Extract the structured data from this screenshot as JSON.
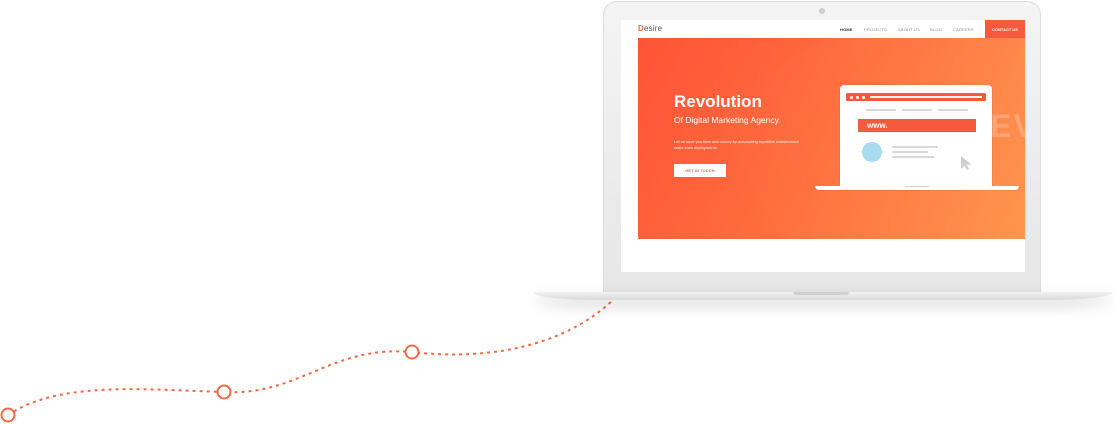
{
  "site": {
    "logo_initial": "D",
    "logo_rest": "esire",
    "nav": [
      {
        "label": "HOME",
        "active": true
      },
      {
        "label": "PROJECTS",
        "active": false
      },
      {
        "label": "ABOUT US",
        "active": false
      },
      {
        "label": "BLOG",
        "active": false
      },
      {
        "label": "CAREERS",
        "active": false
      }
    ],
    "contact_button": "CONTACT US"
  },
  "hero": {
    "title": "Revolution",
    "subtitle": "Of Digital Marketing Agency",
    "body": "Let us save you time and money by automating repetitive maintenance tasks such deployments",
    "cta": "GET IN TOUCH",
    "background_letters": "EV",
    "illustration_url_text": "www."
  },
  "colors": {
    "accent": "#f55a3c",
    "hero_gradient_start": "#ff5338",
    "hero_gradient_end": "#ff8f44",
    "path_dots": "#f26a47"
  },
  "icons": {
    "cursor": "cursor-icon",
    "browser_dots": "browser-dots-icon"
  }
}
